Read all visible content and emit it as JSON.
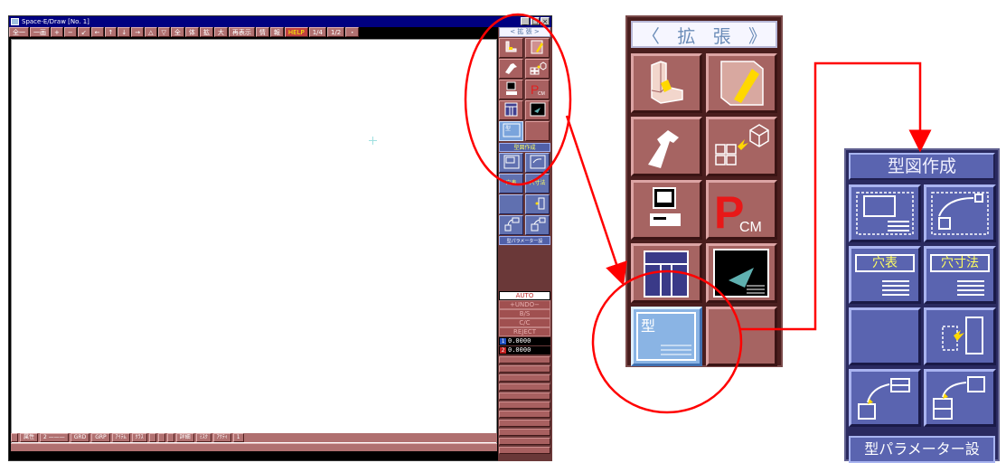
{
  "window": {
    "title": "Space-E/Draw [No. 1]",
    "controls": [
      "_",
      "□",
      "×"
    ]
  },
  "menubar": {
    "items": [
      "全一",
      "一画",
      "+",
      "−",
      "↙",
      "←",
      "↑",
      "↓",
      "→",
      "△",
      "▽",
      "全",
      "体",
      "拡",
      "大",
      "再表示",
      "情",
      "報",
      "HELP",
      "1/4",
      "1/2",
      "・"
    ]
  },
  "statusbar": {
    "fields": [
      "",
      "属性",
      "2 ———",
      "GRD",
      "GRP",
      "ｱｲﾃﾑ",
      "ｸﾗｽ",
      "",
      "",
      "",
      "詳細",
      "ﾐｽｸ",
      "ｱｸﾃｨ",
      "1"
    ]
  },
  "rightbar": {
    "header": "< 拡 張 >",
    "section_label": "型図作成",
    "tiles": {
      "hole_table": "穴表",
      "hole_dim": "穴寸法"
    },
    "param_label": "型パラメーター設",
    "auto": "AUTO",
    "undo": "+UNDO−",
    "bs": "B/S",
    "cc": "C/C",
    "reject": "REJECT",
    "coords": [
      {
        "index": "1",
        "value": "0.0000"
      },
      {
        "index": "2",
        "value": "0.0000"
      }
    ]
  },
  "zoom1": {
    "left_arrow": "〈",
    "title_1": "拡",
    "title_2": "張",
    "right_arrow": "》",
    "pcm_p": "P",
    "pcm_sub": "CM",
    "mold_label": "型"
  },
  "zoom2": {
    "title": "型図作成",
    "hole_table_label": "穴表",
    "hole_dim_label": "穴寸法",
    "footer": "型パラメーター設"
  },
  "colors": {
    "annotation": "#ff0000",
    "maroon_panel": "#4a1e1e",
    "blue_panel": "#2a2a60"
  }
}
